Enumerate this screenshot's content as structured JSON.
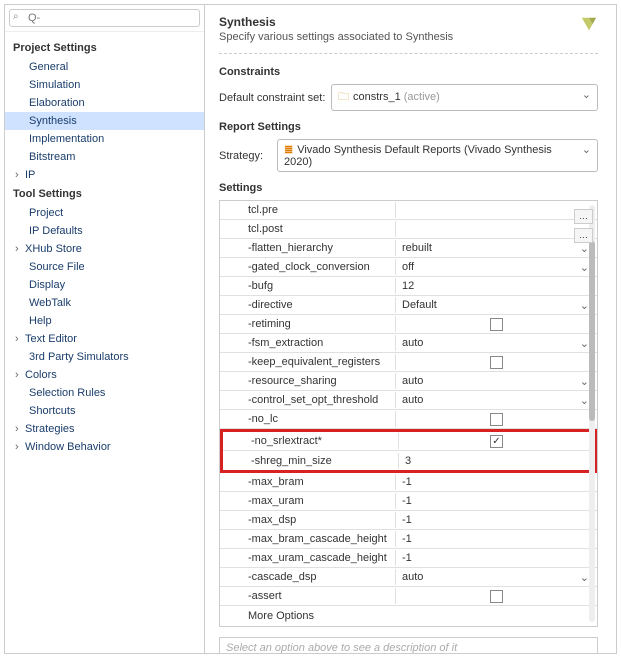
{
  "search": {
    "placeholder": "Q-"
  },
  "leftPanel": {
    "group1Title": "Project Settings",
    "group1": [
      {
        "label": "General"
      },
      {
        "label": "Simulation"
      },
      {
        "label": "Elaboration"
      },
      {
        "label": "Synthesis",
        "selected": true
      },
      {
        "label": "Implementation"
      },
      {
        "label": "Bitstream"
      },
      {
        "label": "IP",
        "expandable": true
      }
    ],
    "group2Title": "Tool Settings",
    "group2": [
      {
        "label": "Project"
      },
      {
        "label": "IP Defaults"
      },
      {
        "label": "XHub Store",
        "expandable": true
      },
      {
        "label": "Source File"
      },
      {
        "label": "Display"
      },
      {
        "label": "WebTalk"
      },
      {
        "label": "Help"
      },
      {
        "label": "Text Editor",
        "expandable": true
      },
      {
        "label": "3rd Party Simulators"
      },
      {
        "label": "Colors",
        "expandable": true
      },
      {
        "label": "Selection Rules"
      },
      {
        "label": "Shortcuts"
      },
      {
        "label": "Strategies",
        "expandable": true
      },
      {
        "label": "Window Behavior",
        "expandable": true
      }
    ]
  },
  "header": {
    "title": "Synthesis",
    "subtitle": "Specify various settings associated to Synthesis"
  },
  "constraints": {
    "section": "Constraints",
    "label": "Default constraint set:",
    "value": "constrs_1",
    "suffix": "(active)"
  },
  "reports": {
    "section": "Report Settings",
    "label": "Strategy:",
    "value": "Vivado Synthesis Default Reports (Vivado Synthesis 2020)"
  },
  "settings": {
    "section": "Settings",
    "rows": [
      {
        "key": "tcl.pre",
        "type": "ellipsis"
      },
      {
        "key": "tcl.post",
        "type": "ellipsis"
      },
      {
        "key": "-flatten_hierarchy",
        "value": "rebuilt",
        "type": "dropdown"
      },
      {
        "key": "-gated_clock_conversion",
        "value": "off",
        "type": "dropdown"
      },
      {
        "key": "-bufg",
        "value": "12",
        "type": "text"
      },
      {
        "key": "-directive",
        "value": "Default",
        "type": "dropdown"
      },
      {
        "key": "-retiming",
        "type": "checkbox",
        "checked": false
      },
      {
        "key": "-fsm_extraction",
        "value": "auto",
        "type": "dropdown"
      },
      {
        "key": "-keep_equivalent_registers",
        "type": "checkbox",
        "checked": false
      },
      {
        "key": "-resource_sharing",
        "value": "auto",
        "type": "dropdown"
      },
      {
        "key": "-control_set_opt_threshold",
        "value": "auto",
        "type": "dropdown"
      },
      {
        "key": "-no_lc",
        "type": "checkbox",
        "checked": false
      },
      {
        "key": "-no_srlextract*",
        "type": "checkbox",
        "checked": true,
        "highlight": true
      },
      {
        "key": "-shreg_min_size",
        "value": "3",
        "type": "text",
        "highlight": true
      },
      {
        "key": "-max_bram",
        "value": "-1",
        "type": "text"
      },
      {
        "key": "-max_uram",
        "value": "-1",
        "type": "text"
      },
      {
        "key": "-max_dsp",
        "value": "-1",
        "type": "text"
      },
      {
        "key": "-max_bram_cascade_height",
        "value": "-1",
        "type": "text"
      },
      {
        "key": "-max_uram_cascade_height",
        "value": "-1",
        "type": "text"
      },
      {
        "key": "-cascade_dsp",
        "value": "auto",
        "type": "dropdown"
      },
      {
        "key": "-assert",
        "type": "checkbox",
        "checked": false
      }
    ],
    "moreOptions": "More Options"
  },
  "description": {
    "placeholder": "Select an option above to see a description of it"
  }
}
